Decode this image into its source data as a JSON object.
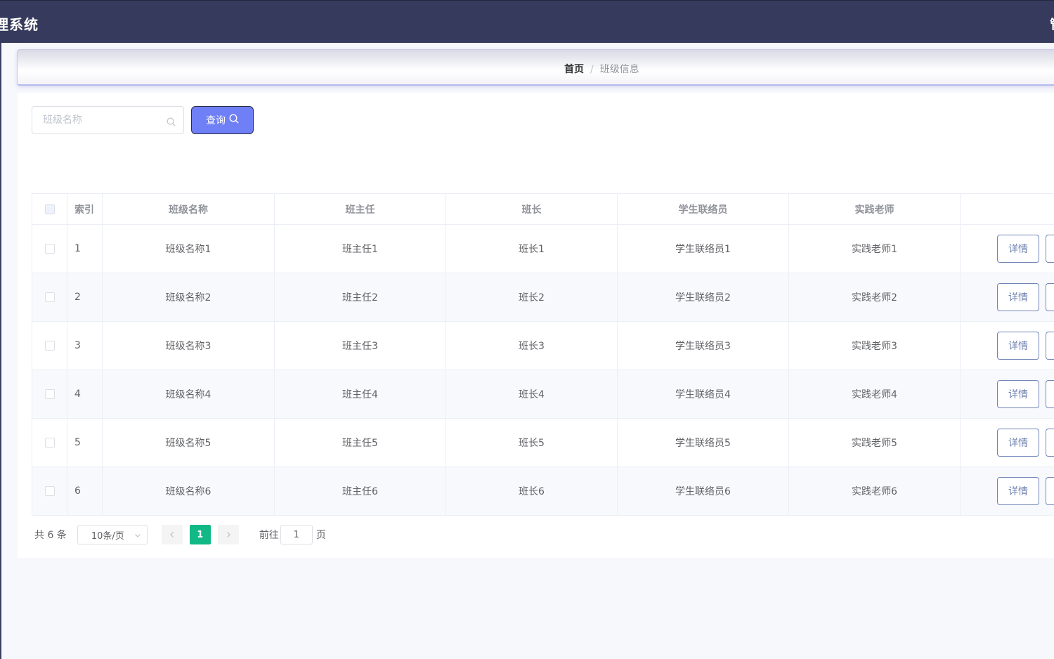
{
  "header": {
    "title": "理系统",
    "right_text": "管"
  },
  "breadcrumb": {
    "home": "首页",
    "separator": "/",
    "current": "班级信息"
  },
  "search": {
    "placeholder": "班级名称",
    "value": "",
    "icon": "search-icon"
  },
  "query_button": {
    "label": "查询",
    "icon": "search-icon"
  },
  "table": {
    "columns": [
      "索引",
      "班级名称",
      "班主任",
      "班长",
      "学生联络员",
      "实践老师",
      ""
    ],
    "rows": [
      {
        "index": "1",
        "class_name": "班级名称1",
        "head_teacher": "班主任1",
        "monitor": "班长1",
        "liaison": "学生联络员1",
        "practice_teacher": "实践老师1",
        "detail": "详情"
      },
      {
        "index": "2",
        "class_name": "班级名称2",
        "head_teacher": "班主任2",
        "monitor": "班长2",
        "liaison": "学生联络员2",
        "practice_teacher": "实践老师2",
        "detail": "详情"
      },
      {
        "index": "3",
        "class_name": "班级名称3",
        "head_teacher": "班主任3",
        "monitor": "班长3",
        "liaison": "学生联络员3",
        "practice_teacher": "实践老师3",
        "detail": "详情"
      },
      {
        "index": "4",
        "class_name": "班级名称4",
        "head_teacher": "班主任4",
        "monitor": "班长4",
        "liaison": "学生联络员4",
        "practice_teacher": "实践老师4",
        "detail": "详情"
      },
      {
        "index": "5",
        "class_name": "班级名称5",
        "head_teacher": "班主任5",
        "monitor": "班长5",
        "liaison": "学生联络员5",
        "practice_teacher": "实践老师5",
        "detail": "详情"
      },
      {
        "index": "6",
        "class_name": "班级名称6",
        "head_teacher": "班主任6",
        "monitor": "班长6",
        "liaison": "学生联络员6",
        "practice_teacher": "实践老师6",
        "detail": "详情"
      }
    ]
  },
  "pagination": {
    "total_text": "共 6 条",
    "page_size": "10条/页",
    "current_page": "1",
    "goto_label": "前往",
    "goto_value": "1",
    "page_unit": "页"
  },
  "colors": {
    "topbar": "#363a5c",
    "primary_button": "#6f7ff5",
    "active_page": "#12b886",
    "detail_border": "#7185b8"
  }
}
